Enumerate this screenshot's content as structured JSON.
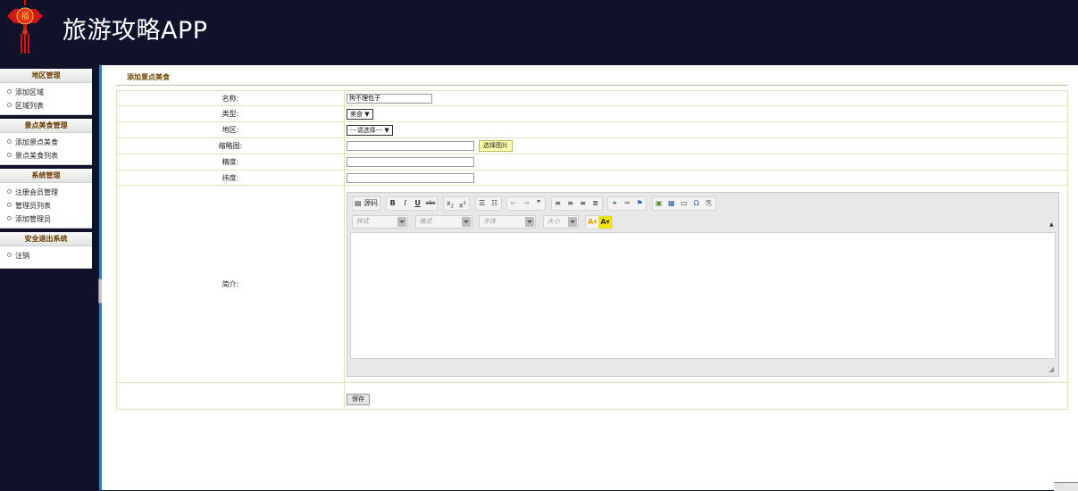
{
  "app": {
    "title": "旅游攻略APP",
    "logo_text": "福"
  },
  "sidebar": {
    "groups": [
      {
        "title": "地区管理",
        "items": [
          "添加区域",
          "区域列表"
        ]
      },
      {
        "title": "景点美食管理",
        "items": [
          "添加景点美食",
          "景点美食列表"
        ]
      },
      {
        "title": "系统管理",
        "items": [
          "注册会员管理",
          "管理员列表",
          "添加管理员"
        ]
      },
      {
        "title": "安全退出系统",
        "items": [
          "注销"
        ]
      }
    ]
  },
  "page": {
    "title": "添加景点美食"
  },
  "form": {
    "name_label": "名称:",
    "name_value": "狗不理包子",
    "type_label": "类型:",
    "type_value": "美食",
    "region_label": "地区:",
    "region_value": "---请选择---",
    "thumb_label": "缩略图:",
    "thumb_value": "",
    "choose_image": "选择图片",
    "lng_label": "精度:",
    "lng_value": "",
    "lat_label": "纬度:",
    "lat_value": "",
    "intro_label": "简介:",
    "save": "保存"
  },
  "editor": {
    "source_label": "源码",
    "combos": [
      "样式",
      "格式",
      "字体",
      "大小"
    ],
    "colors": {
      "text_color": "#e6a000",
      "bg_color": "#f2e600"
    }
  },
  "colors": {
    "header_bg": "#10112a",
    "divider": "#2f80c8",
    "menu_header_text": "#6a3d00",
    "page_title": "#6b4a00",
    "choose_btn_bg": "#ffffa8"
  }
}
